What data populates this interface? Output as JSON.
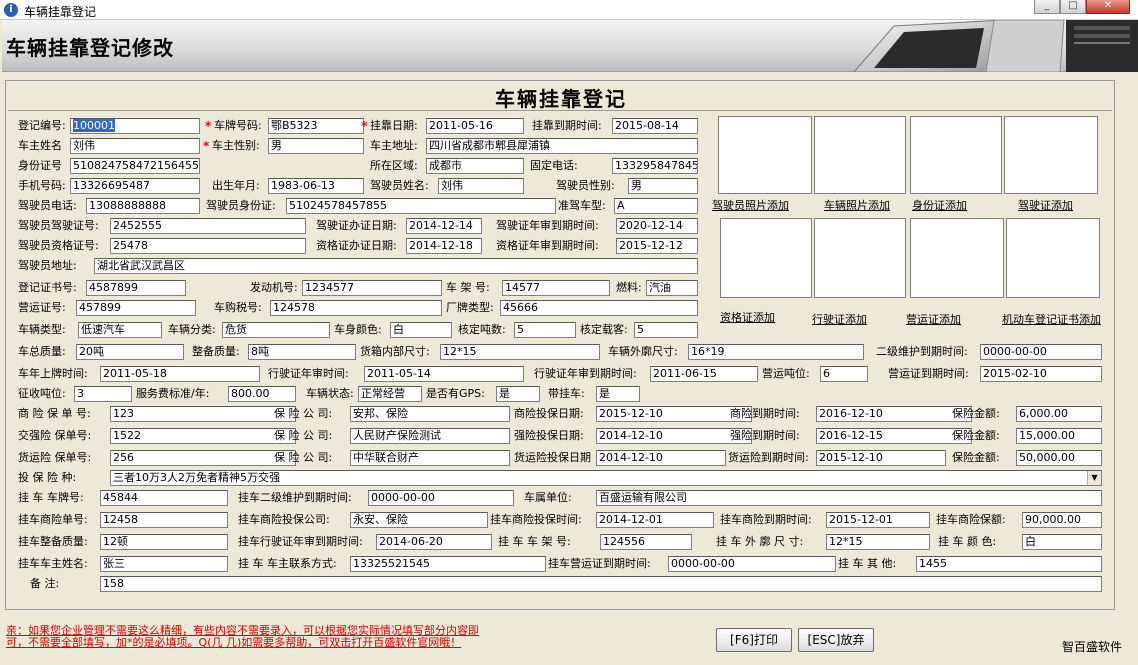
{
  "window": {
    "title": "车辆挂靠登记",
    "min": "_",
    "max": "□",
    "close": "✕"
  },
  "banner": {
    "title": "车辆挂靠登记修改"
  },
  "form": {
    "title": "车辆挂靠登记",
    "rows": [
      [
        {
          "label": "登记编号:",
          "value": "100001",
          "sel": true
        },
        {
          "label": "车牌号码:",
          "value": "鄂B5323",
          "req": true
        },
        {
          "label": "挂靠日期:",
          "value": "2011-05-16",
          "req": true
        },
        {
          "label": "挂靠到期时间:",
          "value": "2015-08-14"
        }
      ]
    ],
    "fields": {
      "reg_no": {
        "label": "登记编号:",
        "value": "100001"
      },
      "plate": {
        "label": "车牌号码:",
        "value": "鄂B5323"
      },
      "attach_date": {
        "label": "挂靠日期:",
        "value": "2011-05-16"
      },
      "attach_end": {
        "label": "挂靠到期时间:",
        "value": "2015-08-14"
      },
      "owner_name": {
        "label": "车主姓名",
        "value": "刘伟"
      },
      "owner_sex": {
        "label": "车主性别:",
        "value": "男"
      },
      "owner_addr": {
        "label": "车主地址:",
        "value": "四川省成都市郫县犀浦镇"
      },
      "id_no": {
        "label": "身份证号",
        "value": "510824758472156455"
      },
      "area": {
        "label": "所在区域:",
        "value": "成都市"
      },
      "phone": {
        "label": "固定电话:",
        "value": "133295847845"
      },
      "mobile": {
        "label": "手机号码:",
        "value": "13326695487"
      },
      "birth": {
        "label": "出生年月:",
        "value": "1983-06-13"
      },
      "driver_name": {
        "label": "驾驶员姓名:",
        "value": "刘伟"
      },
      "driver_sex": {
        "label": "驾驶员性别:",
        "value": "男"
      },
      "driver_phone": {
        "label": "驾驶员电话:",
        "value": "13088888888"
      },
      "driver_id": {
        "label": "驾驶员身份证:",
        "value": "51024578457855"
      },
      "license_type": {
        "label": "准驾车型:",
        "value": "A"
      },
      "license_no": {
        "label": "驾驶员驾驶证号:",
        "value": "2452555"
      },
      "license_issue": {
        "label": "驾驶证办证日期:",
        "value": "2014-12-14"
      },
      "license_review": {
        "label": "驾驶证年审到期时间:",
        "value": "2020-12-14"
      },
      "qual_no": {
        "label": "驾驶员资格证号:",
        "value": "25478"
      },
      "qual_issue": {
        "label": "资格证办证日期:",
        "value": "2014-12-18"
      },
      "qual_review": {
        "label": "资格证年审到期时间:",
        "value": "2015-12-12"
      },
      "driver_addr": {
        "label": "驾驶员地址:",
        "value": "湖北省武汉武昌区"
      },
      "reg_cert": {
        "label": "登记证书号:",
        "value": "4587899"
      },
      "engine": {
        "label": "发动机号:",
        "value": "1234577"
      },
      "frame": {
        "label": "车 架 号:",
        "value": "14577"
      },
      "fuel": {
        "label": "燃料:",
        "value": "汽油"
      },
      "transport": {
        "label": "营运证号:",
        "value": "457899"
      },
      "purchase_tax": {
        "label": "车购税号:",
        "value": "124578"
      },
      "factory_type": {
        "label": "厂牌类型:",
        "value": "45666"
      },
      "vehicle_type": {
        "label": "车辆类型:",
        "value": "低速汽车"
      },
      "vehicle_class": {
        "label": "车辆分类:",
        "value": "危货"
      },
      "color": {
        "label": "车身颜色:",
        "value": "白"
      },
      "tonnage": {
        "label": "核定吨数:",
        "value": "5"
      },
      "seats": {
        "label": "核定载客:",
        "value": "5"
      },
      "total_mass": {
        "label": "车总质量:",
        "value": "20吨"
      },
      "curb_mass": {
        "label": "整备质量:",
        "value": "8吨"
      },
      "box_size": {
        "label": "货箱内部尺寸:",
        "value": "12*15"
      },
      "outer_size": {
        "label": "车辆外廓尺寸:",
        "value": "16*19"
      },
      "maint_end": {
        "label": "二级维护到期时间:",
        "value": "0000-00-00"
      },
      "first_reg": {
        "label": "车年上牌时间:",
        "value": "2011-05-18"
      },
      "review": {
        "label": "行驶证年审时间:",
        "value": "2011-05-14"
      },
      "review_end": {
        "label": "行驶证年审到期时间:",
        "value": "2011-06-15"
      },
      "op_tons": {
        "label": "营运吨位:",
        "value": "6"
      },
      "op_end": {
        "label": "营运证到期时间:",
        "value": "2015-02-10"
      },
      "levy": {
        "label": "征收吨位:",
        "value": "3"
      },
      "fee": {
        "label": "服务费标准/年:",
        "value": "800.00"
      },
      "status": {
        "label": "车辆状态:",
        "value": "正常经营"
      },
      "gps": {
        "label": "是否有GPS:",
        "value": "是"
      },
      "trailer": {
        "label": "带挂车:",
        "value": "是"
      },
      "comm_no": {
        "label": "商 险 保 单 号:",
        "value": "123"
      },
      "comm_co": {
        "label": "保 险 公 司:",
        "value": "安邦、保险"
      },
      "comm_date": {
        "label": "商险投保日期:",
        "value": "2015-12-10"
      },
      "comm_end": {
        "label": "商险到期时间:",
        "value": "2016-12-10"
      },
      "comm_amt": {
        "label": "保险金额:",
        "value": "6,000.00"
      },
      "comp_no": {
        "label": "交强险 保单号:",
        "value": "1522"
      },
      "comp_co": {
        "label": "保 险 公 司:",
        "value": "人民财产保险测试"
      },
      "comp_date": {
        "label": "强险投保日期:",
        "value": "2014-12-10"
      },
      "comp_end": {
        "label": "强险到期时间:",
        "value": "2016-12-15"
      },
      "comp_amt": {
        "label": "保险金额:",
        "value": "15,000.00"
      },
      "cargo_no": {
        "label": "货运险 保单号:",
        "value": "256"
      },
      "cargo_co": {
        "label": "保 险 公 司:",
        "value": "中华联合财产"
      },
      "cargo_date": {
        "label": "货运险投保日期",
        "value": "2014-12-10"
      },
      "cargo_end": {
        "label": "货运险到期时间:",
        "value": "2015-12-10"
      },
      "cargo_amt": {
        "label": "保险金额:",
        "value": "50,000.00"
      },
      "ins_type": {
        "label": "投 保 险 种:",
        "value": "三者10万3人2万免者精神5万交强"
      },
      "tr_plate": {
        "label": "挂 车 车牌号:",
        "value": "45844"
      },
      "tr_maint": {
        "label": "挂车二级维护到期时间:",
        "value": "0000-00-00"
      },
      "tr_unit": {
        "label": "车属单位:",
        "value": "百盛运输有限公司"
      },
      "tr_comm_no": {
        "label": "挂车商险单号:",
        "value": "12458"
      },
      "tr_comm_co": {
        "label": "挂车商险投保公司:",
        "value": "永安、保险"
      },
      "tr_comm_date": {
        "label": "挂车商险投保时间:",
        "value": "2014-12-01"
      },
      "tr_comm_end": {
        "label": "挂车商险到期时间:",
        "value": "2015-12-01"
      },
      "tr_comm_amt": {
        "label": "挂车商险保额:",
        "value": "90,000.00"
      },
      "tr_mass": {
        "label": "挂车整备质量:",
        "value": "12顿"
      },
      "tr_review": {
        "label": "挂车行驶证年审到期时间:",
        "value": "2014-06-20"
      },
      "tr_frame": {
        "label": "挂 车 车 架 号:",
        "value": "124556"
      },
      "tr_outer": {
        "label": "挂 车 外 廓 尺 寸:",
        "value": "12*15"
      },
      "tr_color": {
        "label": "挂 车 颜 色:",
        "value": "白"
      },
      "tr_owner": {
        "label": "挂车车主姓名:",
        "value": "张三"
      },
      "tr_phone": {
        "label": "挂 车 车主联系方式:",
        "value": "13325521545"
      },
      "tr_op_end": {
        "label": "挂车营运证到期时间:",
        "value": "0000-00-00"
      },
      "tr_other": {
        "label": "挂 车 其 他:",
        "value": "1455"
      },
      "remark": {
        "label": "备  注:",
        "value": "158"
      }
    },
    "photos": {
      "driver": "驾驶员照片添加",
      "vehicle": "车辆照片添加",
      "idcard": "身份证添加",
      "license": "驾驶证添加",
      "qual": "资格证添加",
      "drive_permit": "行驶证添加",
      "transport": "营运证添加",
      "reg_cert": "机动车登记证书添加"
    }
  },
  "notes": {
    "line1": "亲：如果您企业管理不需要这么精细，有些内容不需要录入，可以根据您实际情况填写部分内容即",
    "line2": "可，不需要全部填写，加*的是必填项。Q(几 几)如需要多帮助，可双击打开百盛软件官网哦！"
  },
  "buttons": {
    "print": "[F6]打印",
    "cancel": "[ESC]放弃"
  },
  "brand": "智百盛软件"
}
